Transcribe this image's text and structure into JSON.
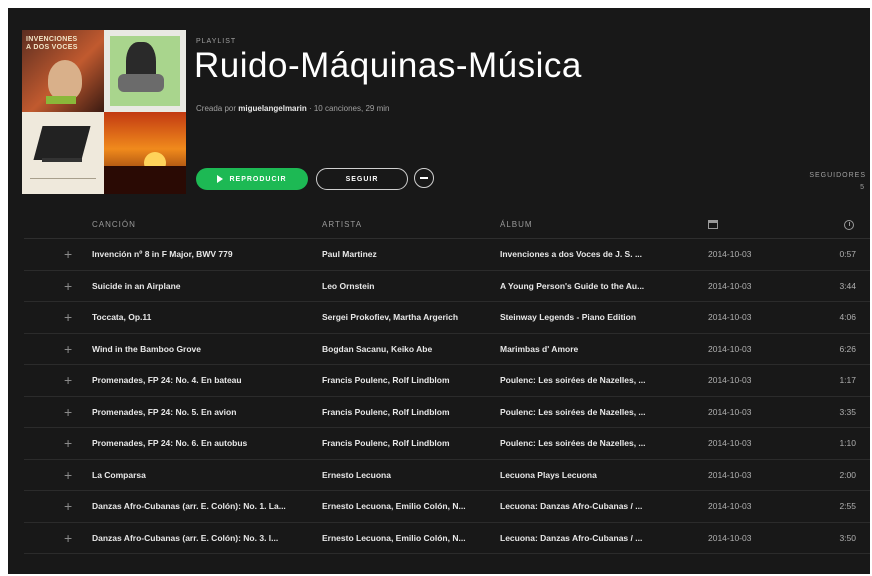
{
  "playlist": {
    "label": "PLAYLIST",
    "title": "Ruido-Máquinas-Música",
    "created_by_prefix": "Creada por",
    "owner": "miguelangelmarin",
    "summary": "· 10 canciones, 29 min"
  },
  "cover": {
    "tile1_caption": "INVENCIONES\nA DOS VOCES"
  },
  "actions": {
    "play_label": "REPRODUCIR",
    "follow_label": "SEGUIR"
  },
  "followers": {
    "label": "SEGUIDORES",
    "count": "5"
  },
  "table": {
    "headers": {
      "song": "CANCIÓN",
      "artist": "ARTISTA",
      "album": "ÁLBUM"
    },
    "rows": [
      {
        "song": "Invención nº 8 in F Major, BWV 779",
        "artist": "Paul Martinez",
        "album": "Invenciones a dos Voces de J. S. ...",
        "date": "2014-10-03",
        "duration": "0:57"
      },
      {
        "song": "Suicide in an Airplane",
        "artist": "Leo Ornstein",
        "album": "A Young Person's Guide to the Au...",
        "date": "2014-10-03",
        "duration": "3:44"
      },
      {
        "song": "Toccata, Op.11",
        "artist": "Sergei Prokofiev, Martha Argerich",
        "album": "Steinway Legends - Piano Edition",
        "date": "2014-10-03",
        "duration": "4:06"
      },
      {
        "song": "Wind in the Bamboo Grove",
        "artist": "Bogdan Sacanu, Keiko Abe",
        "album": "Marimbas d' Amore",
        "date": "2014-10-03",
        "duration": "6:26"
      },
      {
        "song": "Promenades, FP 24: No. 4. En bateau",
        "artist": "Francis Poulenc, Rolf Lindblom",
        "album": "Poulenc: Les soirées de Nazelles, ...",
        "date": "2014-10-03",
        "duration": "1:17"
      },
      {
        "song": "Promenades, FP 24: No. 5. En avion",
        "artist": "Francis Poulenc, Rolf Lindblom",
        "album": "Poulenc: Les soirées de Nazelles, ...",
        "date": "2014-10-03",
        "duration": "3:35"
      },
      {
        "song": "Promenades, FP 24: No. 6. En autobus",
        "artist": "Francis Poulenc, Rolf Lindblom",
        "album": "Poulenc: Les soirées de Nazelles, ...",
        "date": "2014-10-03",
        "duration": "1:10"
      },
      {
        "song": "La Comparsa",
        "artist": "Ernesto Lecuona",
        "album": "Lecuona Plays Lecuona",
        "date": "2014-10-03",
        "duration": "2:00"
      },
      {
        "song": "Danzas Afro-Cubanas (arr. E. Colón): No. 1. La...",
        "artist": "Ernesto Lecuona, Emilio Colón, N...",
        "album": "Lecuona: Danzas Afro-Cubanas / ...",
        "date": "2014-10-03",
        "duration": "2:55"
      },
      {
        "song": "Danzas Afro-Cubanas (arr. E. Colón): No. 3. l...",
        "artist": "Ernesto Lecuona, Emilio Colón, N...",
        "album": "Lecuona: Danzas Afro-Cubanas / ...",
        "date": "2014-10-03",
        "duration": "3:50"
      }
    ]
  },
  "colors": {
    "background": "#181818",
    "accent": "#1db954"
  }
}
